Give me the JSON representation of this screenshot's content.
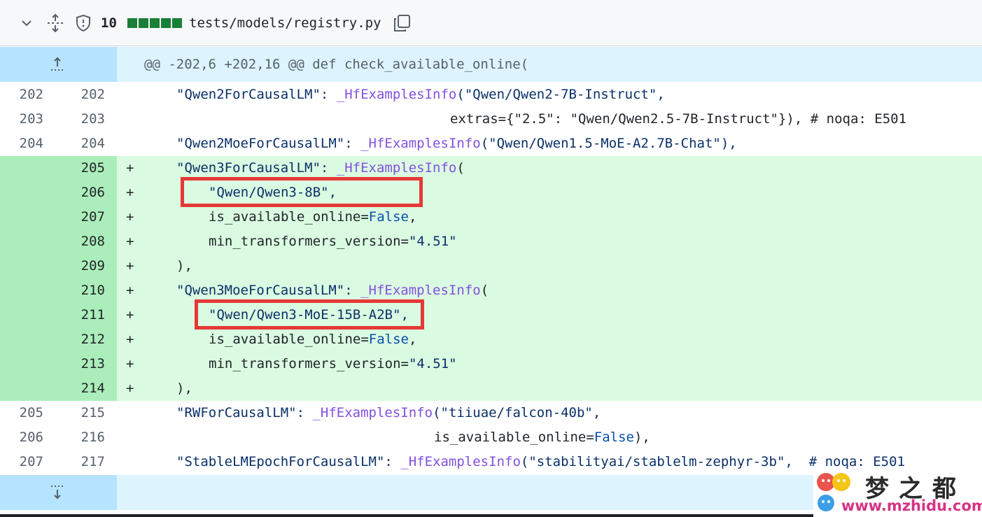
{
  "header": {
    "collapse_icon": "chevron-down-icon",
    "expand_icon": "unfold-icon",
    "security_icon": "shield-icon",
    "additions": "10",
    "diffstat_colors": [
      "#1a7f37",
      "#1a7f37",
      "#1a7f37",
      "#1a7f37",
      "#1a7f37"
    ],
    "filename": "tests/models/registry.py",
    "copy_icon": "copy-icon"
  },
  "hunk_top": {
    "header": "@@ -202,6 +202,16 @@ def check_available_online(",
    "icon": "expand-up-icon"
  },
  "lines": [
    {
      "old": "202",
      "new": "202",
      "marker": "",
      "type": "ctx",
      "indent": 0,
      "parts": [
        {
          "t": "\"Qwen2ForCausalLM\": "
        },
        {
          "t": "_HfExamplesInfo",
          "c": "fn"
        },
        {
          "t": "(\"Qwen/Qwen2-7B-Instruct\","
        }
      ]
    },
    {
      "old": "203",
      "new": "203",
      "marker": "",
      "type": "ctx",
      "indent": 17,
      "parts": [
        {
          "t": "extras={\"2.5\": \"Qwen/Qwen2.5-7B-Instruct\"}), # noqa: E501",
          "c": "plain"
        }
      ]
    },
    {
      "old": "204",
      "new": "204",
      "marker": "",
      "type": "ctx",
      "indent": 0,
      "parts": [
        {
          "t": "\"Qwen2MoeForCausalLM\": "
        },
        {
          "t": "_HfExamplesInfo",
          "c": "fn"
        },
        {
          "t": "(\"Qwen/Qwen1.5-MoE-A2.7B-Chat\"),"
        }
      ]
    },
    {
      "old": "",
      "new": "205",
      "marker": "+",
      "type": "add",
      "indent": 0,
      "parts": [
        {
          "t": "\"Qwen3ForCausalLM\": "
        },
        {
          "t": "_HfExamplesInfo",
          "c": "fn"
        },
        {
          "t": "(",
          "c": "plain"
        }
      ]
    },
    {
      "old": "",
      "new": "206",
      "marker": "+",
      "type": "add",
      "indent": 1,
      "parts": [
        {
          "t": "\"Qwen/Qwen3-8B\","
        }
      ]
    },
    {
      "old": "",
      "new": "207",
      "marker": "+",
      "type": "add",
      "indent": 1,
      "parts": [
        {
          "t": "is_available_online=",
          "c": "plain"
        },
        {
          "t": "False",
          "c": "kw"
        },
        {
          "t": ",",
          "c": "plain"
        }
      ]
    },
    {
      "old": "",
      "new": "208",
      "marker": "+",
      "type": "add",
      "indent": 1,
      "parts": [
        {
          "t": "min_transformers_version=",
          "c": "plain"
        },
        {
          "t": "\"4.51\""
        }
      ]
    },
    {
      "old": "",
      "new": "209",
      "marker": "+",
      "type": "add",
      "indent": 0,
      "parts": [
        {
          "t": "),",
          "c": "plain"
        }
      ]
    },
    {
      "old": "",
      "new": "210",
      "marker": "+",
      "type": "add",
      "indent": 0,
      "parts": [
        {
          "t": "\"Qwen3MoeForCausalLM\": "
        },
        {
          "t": "_HfExamplesInfo",
          "c": "fn"
        },
        {
          "t": "(",
          "c": "plain"
        }
      ]
    },
    {
      "old": "",
      "new": "211",
      "marker": "+",
      "type": "add",
      "indent": 1,
      "parts": [
        {
          "t": "\"Qwen/Qwen3-MoE-15B-A2B\","
        }
      ]
    },
    {
      "old": "",
      "new": "212",
      "marker": "+",
      "type": "add",
      "indent": 1,
      "parts": [
        {
          "t": "is_available_online=",
          "c": "plain"
        },
        {
          "t": "False",
          "c": "kw"
        },
        {
          "t": ",",
          "c": "plain"
        }
      ]
    },
    {
      "old": "",
      "new": "213",
      "marker": "+",
      "type": "add",
      "indent": 1,
      "parts": [
        {
          "t": "min_transformers_version=",
          "c": "plain"
        },
        {
          "t": "\"4.51\""
        }
      ]
    },
    {
      "old": "",
      "new": "214",
      "marker": "+",
      "type": "add",
      "indent": 0,
      "parts": [
        {
          "t": "),",
          "c": "plain"
        }
      ]
    },
    {
      "old": "205",
      "new": "215",
      "marker": "",
      "type": "ctx",
      "indent": 0,
      "parts": [
        {
          "t": "\"RWForCausalLM\": "
        },
        {
          "t": "_HfExamplesInfo",
          "c": "fn"
        },
        {
          "t": "(\"tiiuae/falcon-40b\","
        }
      ]
    },
    {
      "old": "206",
      "new": "216",
      "marker": "",
      "type": "ctx",
      "indent": 16,
      "parts": [
        {
          "t": "is_available_online=",
          "c": "plain"
        },
        {
          "t": "False",
          "c": "kw"
        },
        {
          "t": "),",
          "c": "plain"
        }
      ]
    },
    {
      "old": "207",
      "new": "217",
      "marker": "",
      "type": "ctx",
      "indent": 0,
      "parts": [
        {
          "t": "\"StableLMEpochForCausalLM\": "
        },
        {
          "t": "_HfExamplesInfo",
          "c": "fn"
        },
        {
          "t": "(\"stabilityai/stablelm-zephyr-3b\",  # noqa: E501"
        }
      ]
    }
  ],
  "hunk_bottom": {
    "icon": "expand-down-icon"
  },
  "highlight_color": "#e53935",
  "watermark": {
    "name": "梦之都",
    "url": "www.mzhidu.com"
  }
}
